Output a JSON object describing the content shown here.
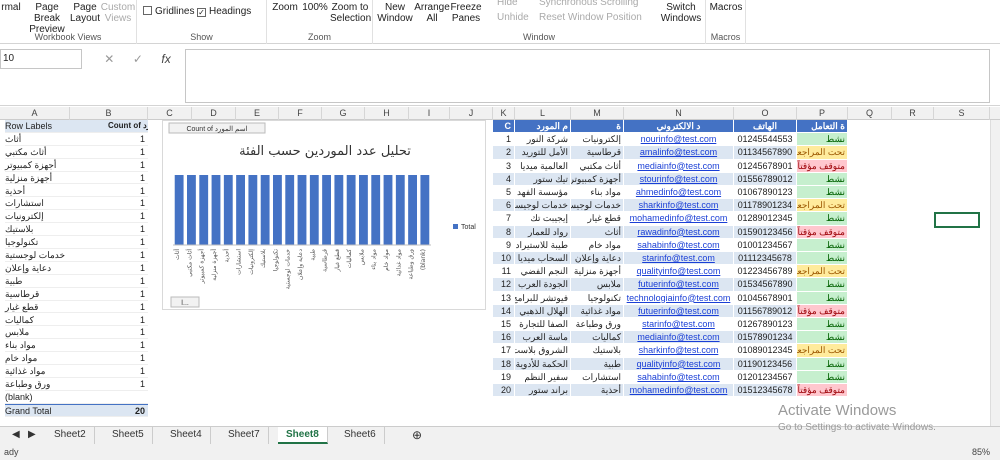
{
  "ribbon": {
    "workbook_views": {
      "label": "Workbook Views",
      "items": [
        "rmal",
        "Page Break Preview",
        "Page Layout",
        "Custom Views"
      ]
    },
    "show": {
      "label": "Show",
      "gridlines": "Gridlines",
      "headings": "Headings"
    },
    "zoom": {
      "label": "Zoom",
      "items": [
        "Zoom",
        "100%",
        "Zoom to Selection"
      ]
    },
    "window": {
      "label": "Window",
      "items": [
        "New Window",
        "Arrange All",
        "Freeze Panes"
      ],
      "hide": "Hide",
      "unhide": "Unhide",
      "sync": "Synchronous Scrolling",
      "reset": "Reset Window Position",
      "switch": "Switch Windows"
    },
    "macros": {
      "label": "Macros",
      "item": "Macros"
    }
  },
  "formula": {
    "name_box": "10",
    "cancel": "✕",
    "enter": "✓",
    "fx": "fx"
  },
  "columns": [
    "A",
    "B",
    "C",
    "D",
    "E",
    "F",
    "G",
    "H",
    "I",
    "J",
    "K",
    "L",
    "M",
    "N",
    "O",
    "P",
    "Q",
    "R",
    "S"
  ],
  "pivot": {
    "header_a": "Row Labels",
    "header_b": "Count of اسم المورد",
    "rows": [
      [
        "أثاث",
        "1"
      ],
      [
        "أثاث مكتبي",
        "1"
      ],
      [
        "أجهزة كمبيوتر",
        "1"
      ],
      [
        "أجهزة منزلية",
        "1"
      ],
      [
        "أحذية",
        "1"
      ],
      [
        "استشارات",
        "1"
      ],
      [
        "إلكترونيات",
        "1"
      ],
      [
        "بلاستيك",
        "1"
      ],
      [
        "تكنولوجيا",
        "1"
      ],
      [
        "خدمات لوجستية",
        "1"
      ],
      [
        "دعاية وإعلان",
        "1"
      ],
      [
        "طبية",
        "1"
      ],
      [
        "قرطاسية",
        "1"
      ],
      [
        "قطع غيار",
        "1"
      ],
      [
        "كماليات",
        "1"
      ],
      [
        "ملابس",
        "1"
      ],
      [
        "مواد بناء",
        "1"
      ],
      [
        "مواد خام",
        "1"
      ],
      [
        "مواد غذائية",
        "1"
      ],
      [
        "ورق وطباعة",
        "1"
      ],
      [
        "(blank)",
        ""
      ]
    ],
    "total_label": "Grand Total",
    "total_value": "20"
  },
  "chart_data": {
    "type": "bar",
    "title": "تحليل عدد الموردين حسب الفئة",
    "field_button": "Count of اسم المورد",
    "legend": "Total",
    "legend_position": "right",
    "categories": [
      "أثاث",
      "أثاث مكتبي",
      "أجهزة كمبيوتر",
      "أجهزة منزلية",
      "أحذية",
      "استشارات",
      "إلكترونيات",
      "بلاستيك",
      "تكنولوجيا",
      "خدمات لوجستية",
      "دعاية وإعلان",
      "طبية",
      "قرطاسية",
      "قطع غيار",
      "كماليات",
      "ملابس",
      "مواد بناء",
      "مواد خام",
      "مواد غذائية",
      "ورق وطباعة",
      "(blank)"
    ],
    "values": [
      1,
      1,
      1,
      1,
      1,
      1,
      1,
      1,
      1,
      1,
      1,
      1,
      1,
      1,
      1,
      1,
      1,
      1,
      1,
      1,
      1
    ],
    "ylim": [
      0,
      1.2
    ],
    "color": "#4472c4",
    "axis_button": "ا..."
  },
  "table": {
    "headers": [
      "C",
      "م المورد",
      "ة",
      "د الالكتروني",
      "الهاتف",
      "ة التعامل"
    ],
    "rows": [
      [
        "1",
        "شركة النور",
        "إلكترونيات",
        "nourinfo@test.com",
        "01245544553",
        "نشط",
        "g"
      ],
      [
        "2",
        "الأمل للتوريد",
        "قرطاسية",
        "amalinfo@test.com",
        "01134567890",
        "تحت المراجعه",
        "y"
      ],
      [
        "3",
        "العالمية ميديا",
        "أثاث مكتبي",
        "mediainfo@test.com",
        "01245678901",
        "متوقف مؤقتاً",
        "r"
      ],
      [
        "4",
        "تيك ستور",
        "أجهزة كمبيوتر",
        "stourinfo@test.com",
        "01556789012",
        "نشط",
        "g"
      ],
      [
        "5",
        "مؤسسة الفهد",
        "مواد بناء",
        "ahmedinfo@test.com",
        "01067890123",
        "نشط",
        "g"
      ],
      [
        "6",
        "خدمات لوجيست المتحدة للشحن",
        "خدمات لوجيست",
        "sharkinfo@test.com",
        "01178901234",
        "تحت المراجعه",
        "y"
      ],
      [
        "7",
        "إيجيبت تك",
        "قطع غيار",
        "mohamedinfo@test.com",
        "01289012345",
        "نشط",
        "g"
      ],
      [
        "8",
        "رواد للعمار",
        "أثاث",
        "rawadinfo@test.com",
        "01590123456",
        "متوقف مؤقتاً",
        "r"
      ],
      [
        "9",
        "طيبة للاستيراد",
        "مواد خام",
        "sahabinfo@test.com",
        "01001234567",
        "نشط",
        "g"
      ],
      [
        "10",
        "السحاب ميديا",
        "دعاية وإعلان",
        "starinfo@test.com",
        "01112345678",
        "نشط",
        "g"
      ],
      [
        "11",
        "النجم الفضي",
        "أجهزة منزلية",
        "qualityinfo@test.com",
        "01223456789",
        "تحت المراجعه",
        "y"
      ],
      [
        "12",
        "الجودة العرب",
        "ملابس",
        "futuerinfo@test.com",
        "01534567890",
        "نشط",
        "g"
      ],
      [
        "13",
        "فيوتشر للبرامج",
        "تكنولوجيا",
        "technologiainfo@test.com",
        "01045678901",
        "نشط",
        "g"
      ],
      [
        "14",
        "الهلال الذهبي",
        "مواد غذائية",
        "futuerinfo@test.com",
        "01156789012",
        "متوقف مؤقتاً",
        "r"
      ],
      [
        "15",
        "الصفا للتجارة",
        "ورق وطباعة",
        "starinfo@test.com",
        "01267890123",
        "نشط",
        "g"
      ],
      [
        "16",
        "ماسة العرب",
        "كماليات",
        "mediainfo@test.com",
        "01578901234",
        "نشط",
        "g"
      ],
      [
        "17",
        "الشروق بلاست",
        "بلاستيك",
        "sharkinfo@test.com",
        "01089012345",
        "تحت المراجعه",
        "y"
      ],
      [
        "18",
        "الحكمة للأدوية",
        "طبية",
        "qualityinfo@test.com",
        "01190123456",
        "نشط",
        "g"
      ],
      [
        "19",
        "سفير النظم",
        "استشارات",
        "sahabinfo@test.com",
        "01201234567",
        "نشط",
        "g"
      ],
      [
        "20",
        "براند ستور",
        "أحذية",
        "mohamedinfo@test.com",
        "01512345678",
        "متوقف مؤقتاً",
        "r"
      ]
    ]
  },
  "tabs": [
    "Sheet2",
    "Sheet5",
    "Sheet4",
    "Sheet7",
    "Sheet8",
    "Sheet6"
  ],
  "active_tab": "Sheet8",
  "add_sheet": "⊕",
  "status": {
    "ready": "ady",
    "zoom": "85%"
  },
  "watermark": {
    "line1": "Activate Windows",
    "line2": "Go to Settings to activate Windows."
  }
}
